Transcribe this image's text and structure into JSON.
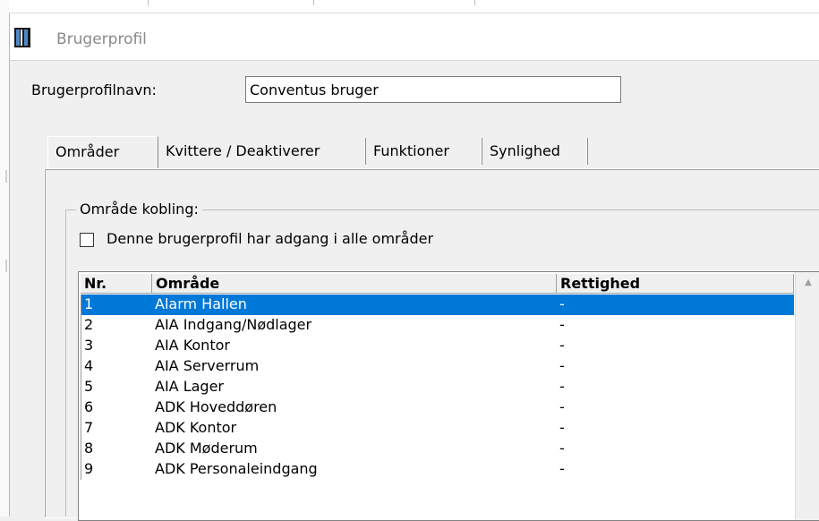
{
  "window": {
    "title": "Brugerprofil",
    "icon": "barcode-app-icon"
  },
  "profile": {
    "name_label": "Brugerprofilnavn:",
    "name_value": "Conventus bruger"
  },
  "tabs": [
    {
      "label": "Områder",
      "active": true
    },
    {
      "label": "Kvittere / Deaktiverer",
      "active": false
    },
    {
      "label": "Funktioner",
      "active": false
    },
    {
      "label": "Synlighed",
      "active": false
    }
  ],
  "group": {
    "label": "Område kobling:",
    "checkbox_label": "Denne brugerprofil har adgang i alle områder",
    "checkbox_checked": false
  },
  "table": {
    "columns": [
      "Nr.",
      "Område",
      "Rettighed"
    ],
    "rows": [
      [
        "1",
        "Alarm Hallen",
        "-"
      ],
      [
        "2",
        "AIA Indgang/Nødlager",
        "-"
      ],
      [
        "3",
        "AIA Kontor",
        "-"
      ],
      [
        "4",
        "AIA Serverrum",
        "-"
      ],
      [
        "5",
        "AIA Lager",
        "-"
      ],
      [
        "6",
        "ADK Hoveddøren",
        "-"
      ],
      [
        "7",
        "ADK Kontor",
        "-"
      ],
      [
        "8",
        "ADK Møderum",
        "-"
      ],
      [
        "9",
        "ADK Personaleindgang",
        "-"
      ]
    ],
    "selected_row": 0
  },
  "colors": {
    "selection": "#0078d7",
    "window_bg": "#f0f0f0"
  }
}
